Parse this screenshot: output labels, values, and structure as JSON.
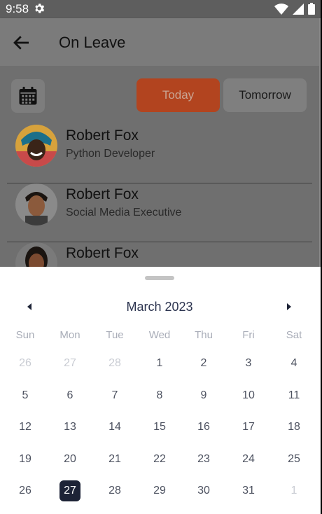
{
  "status_bar": {
    "time": "9:58"
  },
  "app_bar": {
    "title": "On Leave"
  },
  "filters": {
    "today_label": "Today",
    "tomorrow_label": "Tomorrow",
    "selected": "Today"
  },
  "employees": [
    {
      "name": "Robert Fox",
      "role": "Python Developer"
    },
    {
      "name": "Robert Fox",
      "role": "Social Media Executive"
    },
    {
      "name": "Robert Fox",
      "role": ""
    }
  ],
  "calendar": {
    "month_label": "March 2023",
    "weekdays": [
      "Sun",
      "Mon",
      "Tue",
      "Wed",
      "Thu",
      "Fri",
      "Sat"
    ],
    "weeks": [
      [
        "26",
        "27",
        "28",
        "1",
        "2",
        "3",
        "4"
      ],
      [
        "5",
        "6",
        "7",
        "8",
        "9",
        "10",
        "11"
      ],
      [
        "12",
        "13",
        "14",
        "15",
        "16",
        "17",
        "18"
      ],
      [
        "19",
        "20",
        "21",
        "22",
        "23",
        "24",
        "25"
      ],
      [
        "26",
        "27",
        "28",
        "29",
        "30",
        "31",
        "1"
      ]
    ],
    "selected_day": "27",
    "colors": {
      "selected_bg": "#1d2336",
      "accent": "#b2441f",
      "muted_text": "#c9ccd3"
    }
  }
}
